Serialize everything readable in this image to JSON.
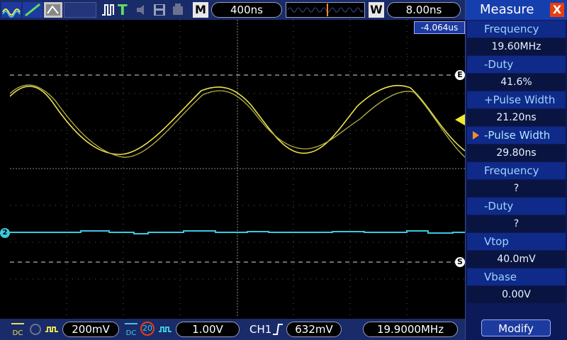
{
  "header": {
    "mode_badge": "M",
    "timebase": "400ns",
    "window_badge": "W",
    "window_value": "8.00ns",
    "trigger_time": "-4.064us"
  },
  "markers": {
    "e": "E",
    "s": "S",
    "ch2": "2"
  },
  "measure": {
    "title": "Measure",
    "close": "X",
    "items": [
      {
        "label": "Frequency",
        "value": "19.60MHz",
        "color": "#9fd3ff"
      },
      {
        "label": "-Duty",
        "value": "41.6%",
        "color": "#9fd3ff"
      },
      {
        "label": "+Pulse Width",
        "value": "21.20ns",
        "color": "#9fd3ff"
      },
      {
        "label": "-Pulse Width",
        "value": "29.80ns",
        "color": "#9fd3ff"
      },
      {
        "label": "Frequency",
        "value": "?",
        "color": "#9fd3ff"
      },
      {
        "label": "-Duty",
        "value": "?",
        "color": "#9fd3ff"
      },
      {
        "label": "Vtop",
        "value": "40.0mV",
        "color": "#9fd3ff"
      },
      {
        "label": "Vbase",
        "value": "0.00V",
        "color": "#9fd3ff"
      }
    ],
    "modify": "Modify"
  },
  "bottom": {
    "ch1_coupling": "DC",
    "ch1_scale": "200mV",
    "ch2_coupling": "DC",
    "ch2_bw": "20",
    "ch2_scale": "1.00V",
    "trig_source": "CH1",
    "trig_level": "632mV",
    "freq_counter": "19.9000MHz"
  },
  "colors": {
    "ch1": "#e8e24a",
    "ch2": "#3cc8e0",
    "accent": "#ff8a2a"
  }
}
